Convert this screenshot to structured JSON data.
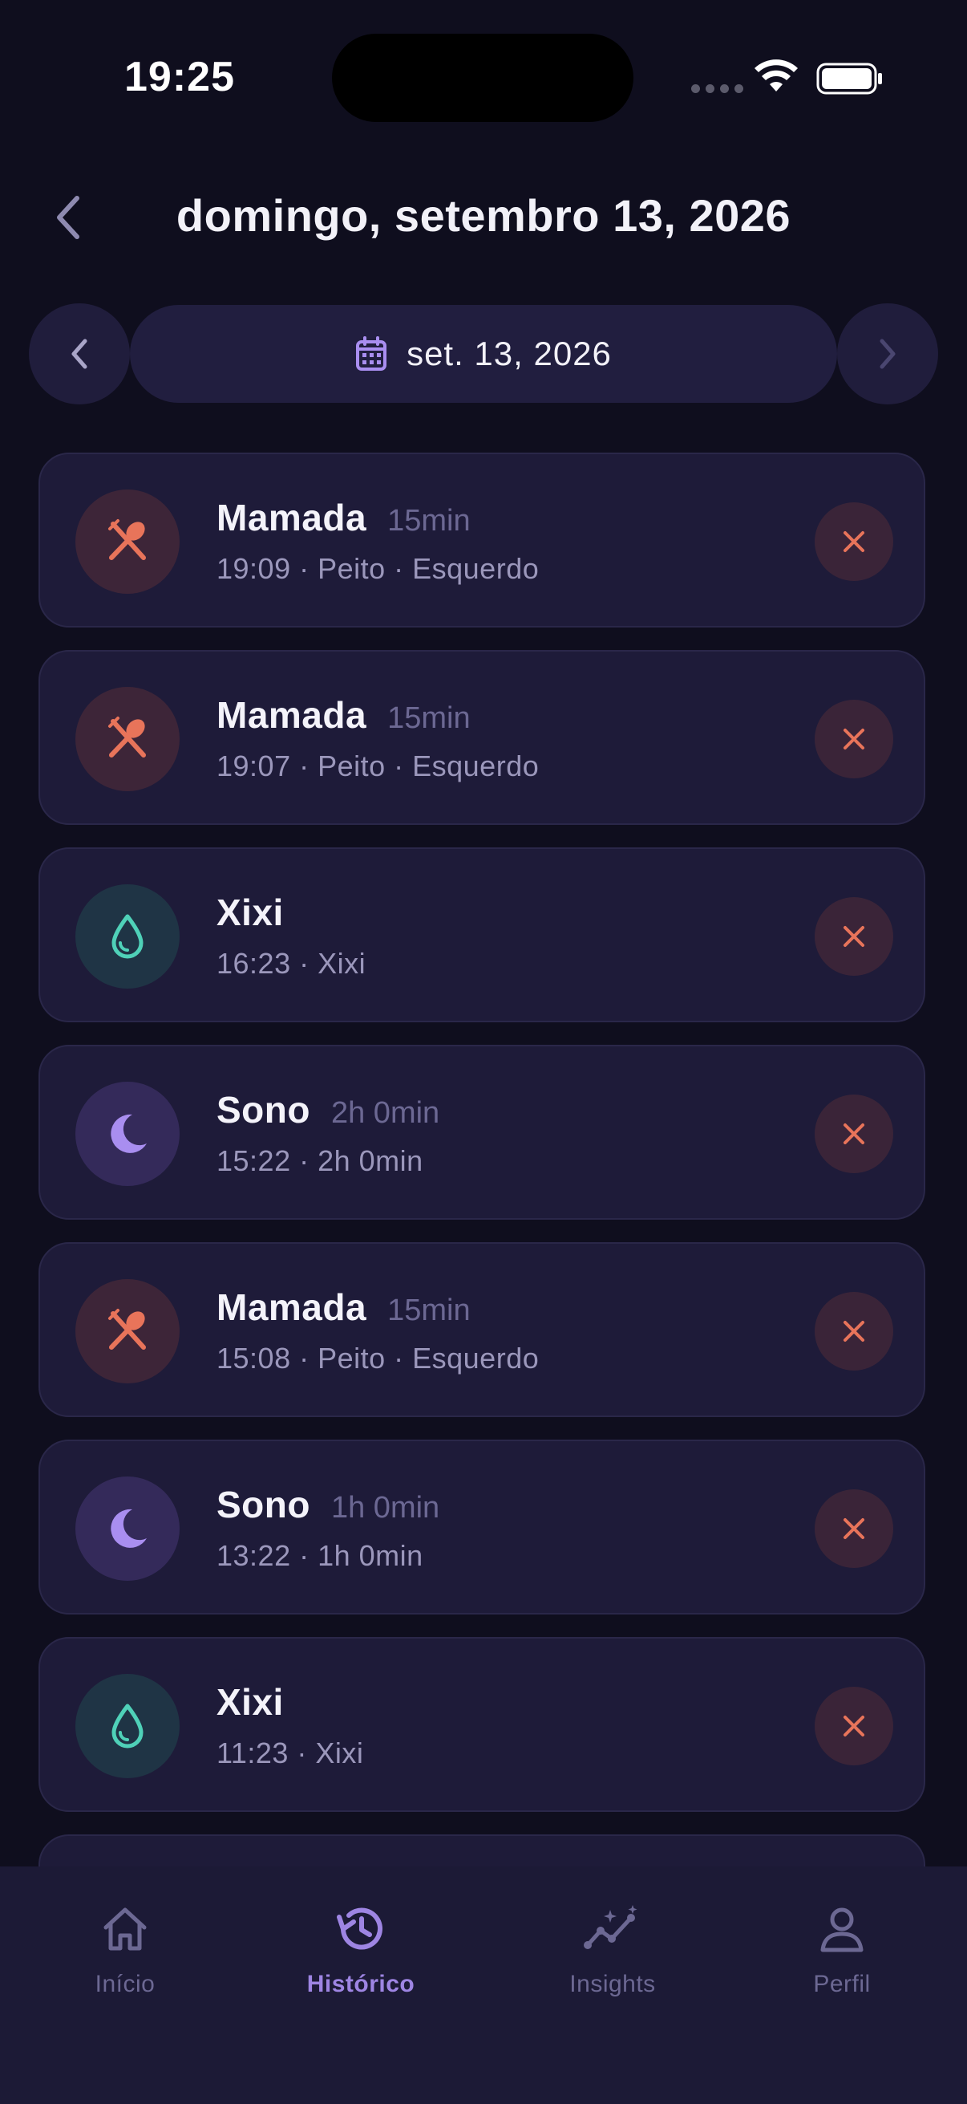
{
  "status_bar": {
    "time": "19:25"
  },
  "header": {
    "title": "domingo, setembro 13, 2026"
  },
  "date_nav": {
    "date_label": "set. 13, 2026"
  },
  "entries": [
    {
      "type": "feed",
      "title": "Mamada",
      "duration": "15min",
      "detail": "19:09 · Peito · Esquerdo"
    },
    {
      "type": "feed",
      "title": "Mamada",
      "duration": "15min",
      "detail": "19:07 · Peito · Esquerdo"
    },
    {
      "type": "pee",
      "title": "Xixi",
      "duration": "",
      "detail": "16:23 · Xixi"
    },
    {
      "type": "sleep",
      "title": "Sono",
      "duration": "2h 0min",
      "detail": "15:22 · 2h 0min"
    },
    {
      "type": "feed",
      "title": "Mamada",
      "duration": "15min",
      "detail": "15:08 · Peito · Esquerdo"
    },
    {
      "type": "sleep",
      "title": "Sono",
      "duration": "1h 0min",
      "detail": "13:22 · 1h 0min"
    },
    {
      "type": "pee",
      "title": "Xixi",
      "duration": "",
      "detail": "11:23 · Xixi"
    }
  ],
  "tabs": [
    {
      "label": "Início",
      "icon": "home-icon",
      "active": false
    },
    {
      "label": "Histórico",
      "icon": "history-icon",
      "active": true
    },
    {
      "label": "Insights",
      "icon": "insights-icon",
      "active": false
    },
    {
      "label": "Perfil",
      "icon": "profile-icon",
      "active": false
    }
  ],
  "colors": {
    "background": "#0f0e1e",
    "card": "#1e1b39",
    "accent": "#9e85e3",
    "feed": "#e8745a",
    "pee": "#4fd1b8",
    "sleep": "#a98ef0",
    "delete": "#e8745a"
  }
}
